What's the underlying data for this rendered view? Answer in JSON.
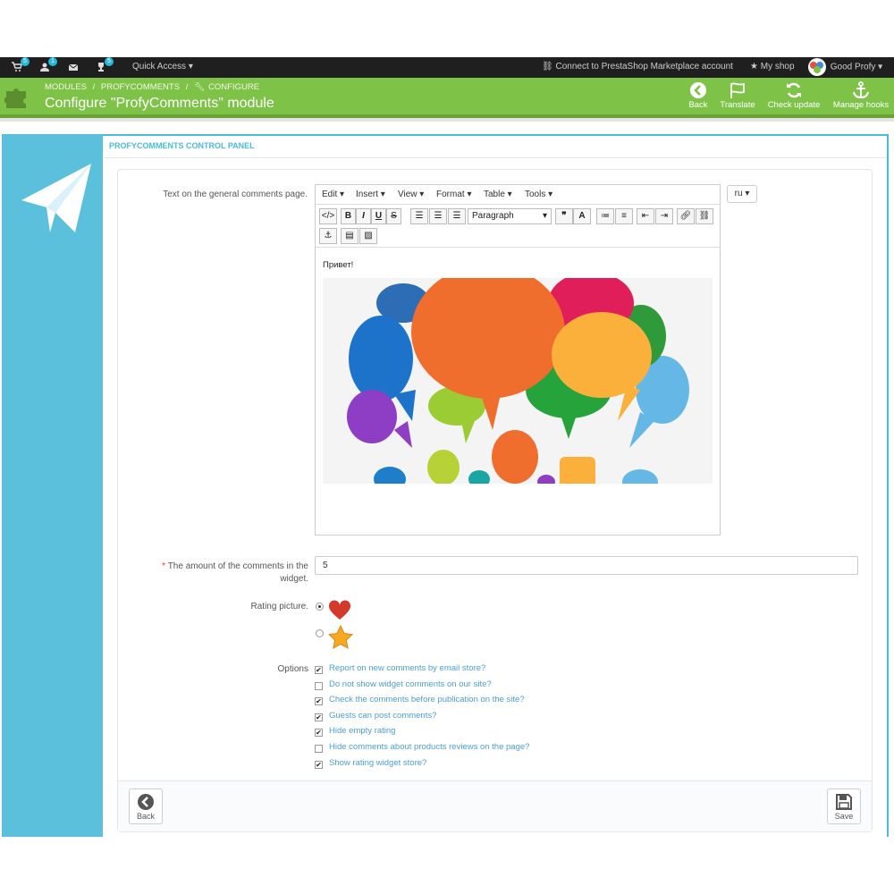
{
  "topbar": {
    "badges": {
      "orders": "5",
      "customers": "1",
      "messages": "",
      "trophies": "5"
    },
    "quick_access": "Quick Access",
    "connect": "Connect to PrestaShop Marketplace account",
    "my_shop": "My shop",
    "user": "Good Profy"
  },
  "header": {
    "breadcrumb": [
      "MODULES",
      "/",
      "PROFYCOMMENTS",
      "/",
      "CONFIGURE"
    ],
    "title": "Configure \"ProfyComments\" module",
    "buttons": {
      "back": "Back",
      "translate": "Translate",
      "check_update": "Check update",
      "manage_hooks": "Manage hooks"
    }
  },
  "panel": {
    "title": "PROFYCOMMENTS CONTROL PANEL",
    "text_label": "Text on the general comments page.",
    "editor": {
      "menus": [
        "Edit",
        "Insert",
        "View",
        "Format",
        "Table",
        "Tools"
      ],
      "format_select": "Paragraph",
      "content": "Привет!"
    },
    "lang": "ru",
    "amount_label_1": "The amount of the comments in the",
    "amount_label_2": "widget.",
    "amount_required": "*",
    "amount_value": "5",
    "rating_label": "Rating picture.",
    "rating_selected": "heart",
    "options_label": "Options",
    "options": [
      {
        "label": "Report on new comments by email store?",
        "checked": true
      },
      {
        "label": "Do not show widget comments on our site?",
        "checked": false
      },
      {
        "label": "Check the comments before publication on the site?",
        "checked": true
      },
      {
        "label": "Guests can post comments?",
        "checked": true
      },
      {
        "label": "Hide empty rating",
        "checked": true
      },
      {
        "label": "Hide comments about products reviews on the page?",
        "checked": false
      },
      {
        "label": "Show rating widget store?",
        "checked": true
      }
    ],
    "footer": {
      "back": "Back",
      "save": "Save"
    }
  },
  "colors": {
    "green": "#7ec348",
    "sidebar": "#5ac0dc",
    "link": "#4b9fd6"
  }
}
